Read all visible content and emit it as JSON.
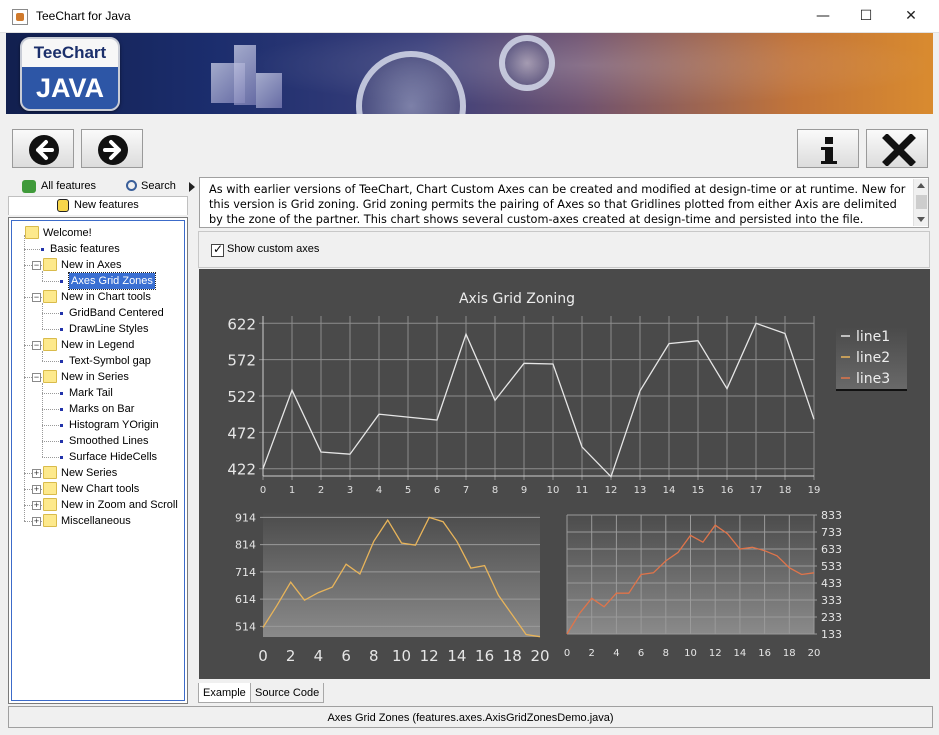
{
  "window": {
    "title": "TeeChart for Java"
  },
  "banner": {
    "logo_top": "TeeChart",
    "logo_bottom": "JAVA"
  },
  "left_tabs": {
    "all_features": "All features",
    "search": "Search",
    "new_features": "New features"
  },
  "tree": [
    {
      "label": "Welcome!",
      "level": 0,
      "type": "folder",
      "expander": ""
    },
    {
      "label": "Basic features",
      "level": 1,
      "type": "leaf",
      "expander": ""
    },
    {
      "label": "New in Axes",
      "level": 1,
      "type": "folder",
      "expander": "-"
    },
    {
      "label": "Axes Grid Zones",
      "level": 2,
      "type": "leaf",
      "expander": "",
      "selected": true
    },
    {
      "label": "New in Chart tools",
      "level": 1,
      "type": "folder",
      "expander": "-"
    },
    {
      "label": "GridBand Centered",
      "level": 2,
      "type": "leaf",
      "expander": ""
    },
    {
      "label": "DrawLine Styles",
      "level": 2,
      "type": "leaf",
      "expander": ""
    },
    {
      "label": "New in Legend",
      "level": 1,
      "type": "folder",
      "expander": "-"
    },
    {
      "label": "Text-Symbol gap",
      "level": 2,
      "type": "leaf",
      "expander": ""
    },
    {
      "label": "New in Series",
      "level": 1,
      "type": "folder",
      "expander": "-"
    },
    {
      "label": "Mark Tail",
      "level": 2,
      "type": "leaf",
      "expander": ""
    },
    {
      "label": "Marks on Bar",
      "level": 2,
      "type": "leaf",
      "expander": ""
    },
    {
      "label": "Histogram YOrigin",
      "level": 2,
      "type": "leaf",
      "expander": ""
    },
    {
      "label": "Smoothed Lines",
      "level": 2,
      "type": "leaf",
      "expander": ""
    },
    {
      "label": "Surface HideCells",
      "level": 2,
      "type": "leaf",
      "expander": ""
    },
    {
      "label": "New Series",
      "level": 1,
      "type": "folder",
      "expander": "+"
    },
    {
      "label": "New Chart tools",
      "level": 1,
      "type": "folder",
      "expander": "+"
    },
    {
      "label": "New in Zoom and Scroll",
      "level": 1,
      "type": "folder",
      "expander": "+"
    },
    {
      "label": "Miscellaneous",
      "level": 1,
      "type": "folder",
      "expander": "+"
    }
  ],
  "description": "As with earlier versions of TeeChart, Chart Custom Axes can be created and modified at design-time or at runtime. New for this version is Grid zoning. Grid zoning permits the pairing of Axes so that Gridlines plotted from either Axis are delimited by the zone of the partner. This chart shows several custom-axes created at design-time and persisted into the file.",
  "options": {
    "show_custom_axes_label": "Show custom axes",
    "show_custom_axes_checked": true
  },
  "bottom_tabs": {
    "example": "Example",
    "source_code": "Source Code"
  },
  "status": "Axes Grid Zones  (features.axes.AxisGridZonesDemo.java)",
  "colors": {
    "line1": "#e6e6e6",
    "line2": "#e8b45a",
    "line3": "#e0744a",
    "chart_bg": "#4a4a4a"
  },
  "chart_data": {
    "type": "line",
    "title": "Axis Grid Zoning",
    "top": {
      "x": [
        0,
        1,
        2,
        3,
        4,
        5,
        6,
        7,
        8,
        9,
        10,
        11,
        12,
        13,
        14,
        15,
        16,
        17,
        18,
        19
      ],
      "y_ticks": [
        422,
        472,
        522,
        572,
        622
      ],
      "ylim": [
        412,
        632
      ],
      "series": [
        {
          "name": "line1",
          "values": [
            422,
            530,
            445,
            442,
            497,
            493,
            489,
            607,
            516,
            567,
            566,
            452,
            411,
            529,
            594,
            598,
            532,
            622,
            608,
            490
          ]
        }
      ]
    },
    "bottom_left": {
      "x_ticks": [
        0,
        2,
        4,
        6,
        8,
        10,
        12,
        14,
        16,
        18,
        20
      ],
      "y_ticks": [
        514,
        614,
        714,
        814,
        914
      ],
      "ylim": [
        475,
        930
      ],
      "series": [
        {
          "name": "line2",
          "x": [
            0,
            1,
            2,
            3,
            4,
            5,
            6,
            7,
            8,
            9,
            10,
            11,
            12,
            13,
            14,
            15,
            16,
            17,
            18,
            19,
            20
          ],
          "values": [
            510,
            590,
            676,
            610,
            638,
            658,
            742,
            706,
            826,
            904,
            820,
            812,
            914,
            898,
            826,
            728,
            737,
            628,
            556,
            484,
            476
          ]
        }
      ]
    },
    "bottom_right": {
      "x_ticks": [
        0,
        2,
        4,
        6,
        8,
        10,
        12,
        14,
        16,
        18,
        20
      ],
      "y_ticks": [
        133,
        233,
        333,
        433,
        533,
        633,
        733,
        833
      ],
      "ylim": [
        133,
        833
      ],
      "series": [
        {
          "name": "line3",
          "x": [
            0,
            1,
            2,
            3,
            4,
            5,
            6,
            7,
            8,
            9,
            10,
            11,
            12,
            13,
            14,
            15,
            16,
            17,
            18,
            19,
            20
          ],
          "values": [
            133,
            253,
            343,
            293,
            373,
            373,
            483,
            493,
            563,
            613,
            713,
            673,
            773,
            723,
            633,
            643,
            623,
            593,
            523,
            483,
            493
          ]
        }
      ]
    },
    "legend": {
      "items": [
        "line1",
        "line2",
        "line3"
      ],
      "position": "right"
    }
  }
}
